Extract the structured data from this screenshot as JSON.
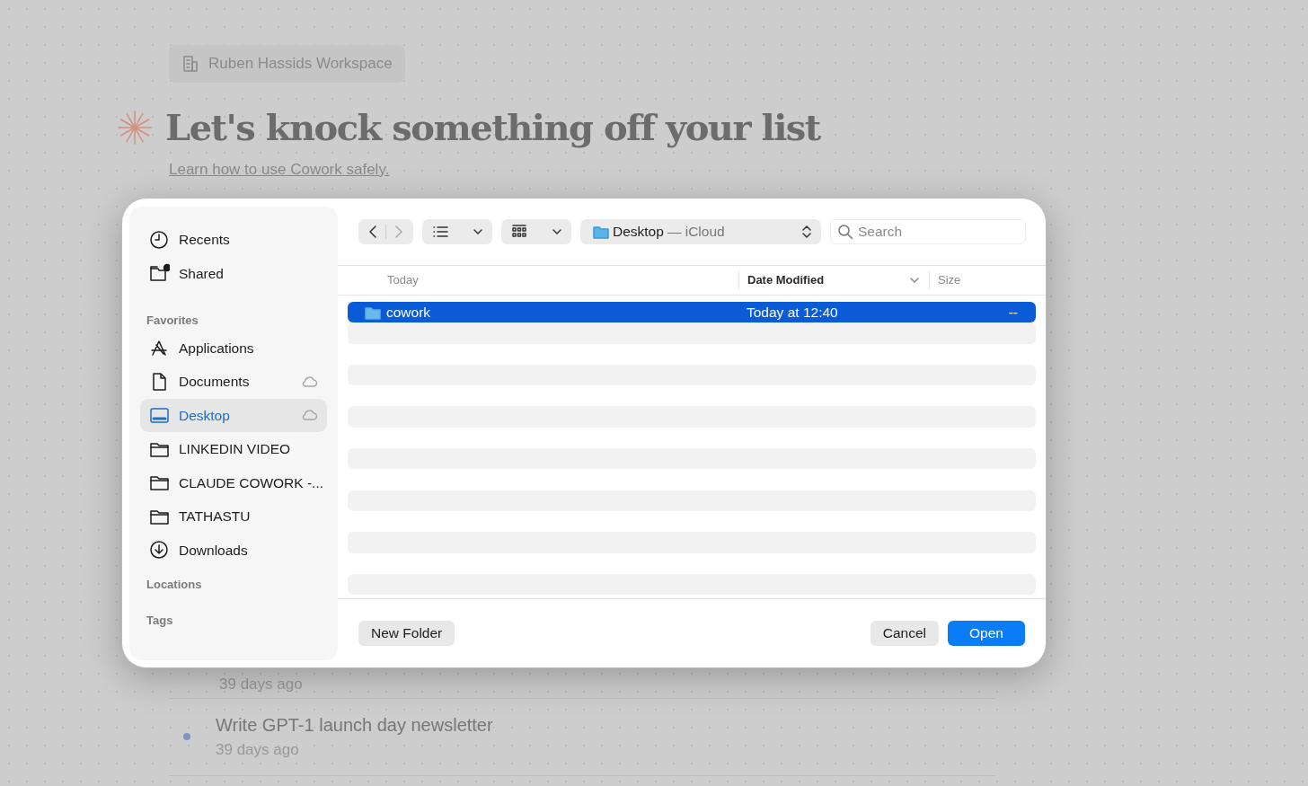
{
  "background": {
    "workspace": "Ruben Hassids Workspace",
    "heading": "Let's knock something off your list",
    "safety_link": "Learn how to use Cowork safely.",
    "tasks": [
      {
        "time": "39 days ago"
      },
      {
        "title": "Write GPT-1 launch day newsletter",
        "time": "39 days ago"
      }
    ]
  },
  "dialog": {
    "toolbar": {
      "location": "Desktop",
      "location_suffix": "— iCloud",
      "search": {
        "placeholder": "Search"
      }
    },
    "sidebar": [
      {
        "items": [
          {
            "kind": "clock",
            "label": "Recents",
            "selected": false,
            "cloud": false
          },
          {
            "kind": "shared",
            "label": "Shared",
            "selected": false,
            "cloud": false
          }
        ]
      },
      {
        "title": "Favorites",
        "items": [
          {
            "kind": "apps",
            "label": "Applications",
            "selected": false,
            "cloud": false
          },
          {
            "kind": "doc",
            "label": "Documents",
            "selected": false,
            "cloud": true
          },
          {
            "kind": "desktop",
            "label": "Desktop",
            "selected": true,
            "cloud": true
          },
          {
            "kind": "folder",
            "label": "LINKEDIN VIDEO",
            "selected": false,
            "cloud": false
          },
          {
            "kind": "folder",
            "label": "CLAUDE COWORK -...",
            "selected": false,
            "cloud": false
          },
          {
            "kind": "folder",
            "label": "TATHASTU",
            "selected": false,
            "cloud": false
          },
          {
            "kind": "download",
            "label": "Downloads",
            "selected": false,
            "cloud": false
          }
        ]
      },
      {
        "title": "Locations"
      },
      {
        "title": "Tags"
      }
    ],
    "columns": [
      {
        "label": "Today",
        "sorted": false
      },
      {
        "label": "Date Modified",
        "sorted": true
      },
      {
        "label": "Size",
        "sorted": false
      }
    ],
    "rows": [
      {
        "name": "cowork",
        "date": "Today at 12:40",
        "size": "--",
        "selected": true
      }
    ],
    "buttons": [
      {
        "label": "New Folder",
        "kind": "secondary"
      },
      {
        "label": "Cancel",
        "kind": "secondary"
      },
      {
        "label": "Open",
        "kind": "primary"
      }
    ]
  }
}
